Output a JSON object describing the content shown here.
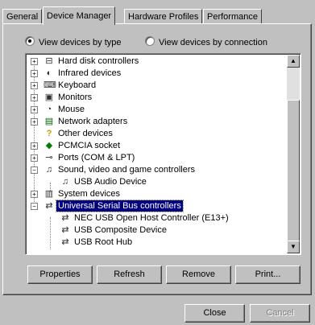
{
  "tabs": [
    {
      "label": "General"
    },
    {
      "label": "Device Manager"
    },
    {
      "label": "Hardware Profiles"
    },
    {
      "label": "Performance"
    }
  ],
  "view_options": {
    "by_type": "View devices by type",
    "by_connection": "View devices by connection",
    "selected": "by_type"
  },
  "tree": [
    {
      "label": "Hard disk controllers",
      "expander": "+",
      "icon": "hard-disk-controller-icon"
    },
    {
      "label": "Infrared devices",
      "expander": "+",
      "icon": "infrared-icon"
    },
    {
      "label": "Keyboard",
      "expander": "+",
      "icon": "keyboard-icon"
    },
    {
      "label": "Monitors",
      "expander": "+",
      "icon": "monitor-icon"
    },
    {
      "label": "Mouse",
      "expander": "+",
      "icon": "mouse-icon"
    },
    {
      "label": "Network adapters",
      "expander": "+",
      "icon": "network-adapter-icon"
    },
    {
      "label": "Other devices",
      "expander": "",
      "icon": "question-icon"
    },
    {
      "label": "PCMCIA socket",
      "expander": "+",
      "icon": "pcmcia-icon"
    },
    {
      "label": "Ports (COM & LPT)",
      "expander": "+",
      "icon": "port-icon"
    },
    {
      "label": "Sound, video and game controllers",
      "expander": "−",
      "icon": "sound-icon"
    },
    {
      "label": "USB Audio Device",
      "expander": "",
      "icon": "usb-audio-icon",
      "child": true
    },
    {
      "label": "System devices",
      "expander": "+",
      "icon": "system-device-icon"
    },
    {
      "label": "Universal Serial Bus controllers",
      "expander": "−",
      "icon": "usb-icon",
      "selected": true
    },
    {
      "label": "NEC USB Open Host Controller (E13+)",
      "expander": "",
      "icon": "usb-icon",
      "child": true
    },
    {
      "label": "USB Composite Device",
      "expander": "",
      "icon": "usb-icon",
      "child": true
    },
    {
      "label": "USB Root Hub",
      "expander": "",
      "icon": "usb-icon",
      "child": true
    }
  ],
  "buttons": {
    "properties": "Properties",
    "refresh": "Refresh",
    "remove": "Remove",
    "print": "Print..."
  },
  "dialog_buttons": {
    "close": "Close",
    "cancel": "Cancel"
  },
  "colors": {
    "face": "#c0c0c0",
    "selection": "#000080"
  }
}
